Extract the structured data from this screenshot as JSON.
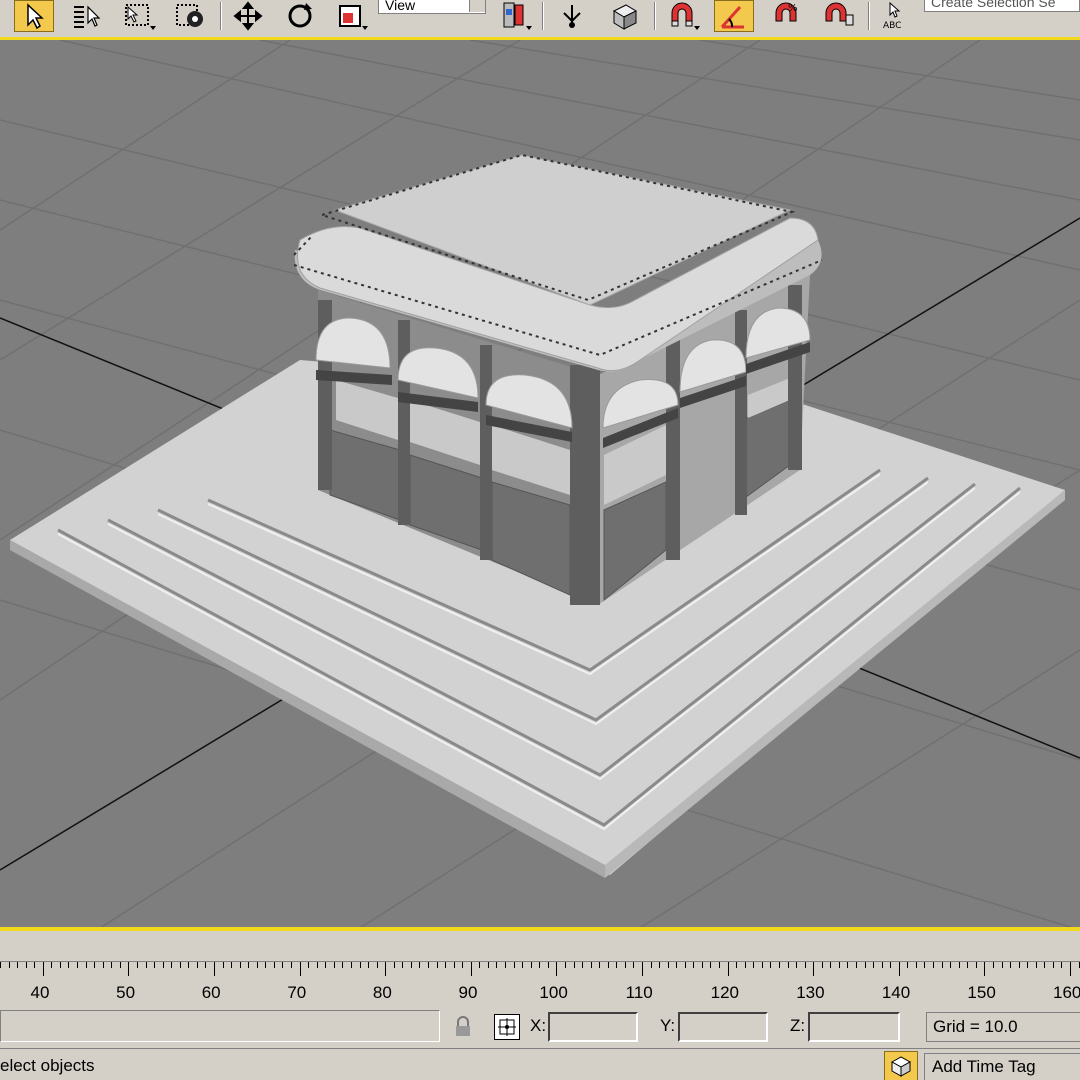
{
  "toolbar": {
    "tools": [
      {
        "name": "select-object",
        "active": true
      },
      {
        "name": "select-by-name",
        "active": false
      },
      {
        "name": "region-select",
        "active": false
      },
      {
        "name": "window-crossing",
        "active": false
      },
      {
        "name": "select-and-move",
        "active": false
      },
      {
        "name": "select-and-rotate",
        "active": false
      },
      {
        "name": "select-and-scale",
        "active": false
      },
      {
        "name": "use-pivot-center",
        "active": false
      },
      {
        "name": "select-and-manipulate",
        "active": false
      },
      {
        "name": "keyboard-shortcut-override",
        "active": false
      },
      {
        "name": "snaps-toggle",
        "active": false
      },
      {
        "name": "angle-snap-toggle",
        "active": true
      },
      {
        "name": "percent-snap-toggle",
        "active": false
      },
      {
        "name": "spinner-snap-toggle",
        "active": false
      },
      {
        "name": "edit-named-selection-sets",
        "active": false
      }
    ],
    "reference_coordinate": "View",
    "named_selection_set": "Create Selection Se",
    "accent_color": "#f2d81c",
    "active_button_color": "#f2c94c"
  },
  "viewport": {
    "background_color": "#7e7e7e",
    "grid_color": "#6f6f6f",
    "model_color": "#cfcfcf"
  },
  "time_ruler": {
    "ticks": [
      "40",
      "50",
      "60",
      "70",
      "80",
      "90",
      "100",
      "110",
      "120",
      "130",
      "140",
      "150",
      "160"
    ]
  },
  "status": {
    "x_label": "X:",
    "y_label": "Y:",
    "z_label": "Z:",
    "x_value": "",
    "y_value": "",
    "z_value": "",
    "grid": "Grid = 10.0",
    "prompt": "elect objects",
    "time_tag": "Add Time Tag"
  }
}
